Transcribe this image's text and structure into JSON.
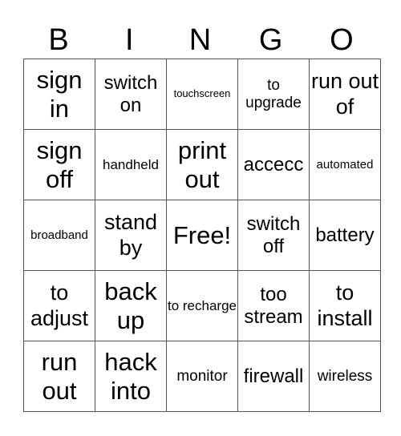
{
  "header": {
    "letters": [
      "B",
      "I",
      "N",
      "G",
      "O"
    ]
  },
  "rows": [
    [
      "sign in",
      "switch on",
      "touchscreen",
      "to upgrade",
      "run out of"
    ],
    [
      "sign off",
      "handheld",
      "print out",
      "accecc",
      "automated"
    ],
    [
      "broadband",
      "stand by",
      "Free!",
      "switch off",
      "battery"
    ],
    [
      "to adjust",
      "back up",
      "to recharge",
      "too stream",
      "to install"
    ],
    [
      "run out",
      "hack into",
      "monitor",
      "firewall",
      "wireless"
    ]
  ]
}
